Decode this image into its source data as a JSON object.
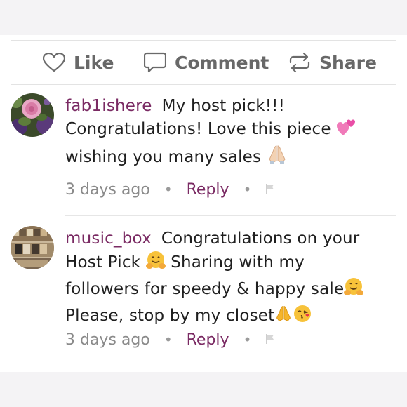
{
  "actions": {
    "like_label": "Like",
    "comment_label": "Comment",
    "share_label": "Share"
  },
  "comments": [
    {
      "username": "fab1ishere",
      "line1": "My host pick!!!",
      "line2": "Congratulations! Love this piece",
      "line3": "wishing you many sales",
      "time": "3 days ago",
      "reply_label": "Reply",
      "avatar": "rose-photo"
    },
    {
      "username": "music_box",
      "line1": "Congratulations on your",
      "line2a": "Host Pick",
      "line2b": "Sharing with my",
      "line3": "followers for speedy & happy sale",
      "line4": "Please, stop by my closet",
      "time": "3 days ago",
      "reply_label": "Reply",
      "avatar": "record-store-photo"
    }
  ],
  "icons": [
    "heart-icon",
    "comment-bubble-icon",
    "share-arrows-icon",
    "flag-icon"
  ],
  "colors": {
    "username": "#7a2a63",
    "reply": "#7a2a63",
    "muted": "#8a8a8a"
  }
}
